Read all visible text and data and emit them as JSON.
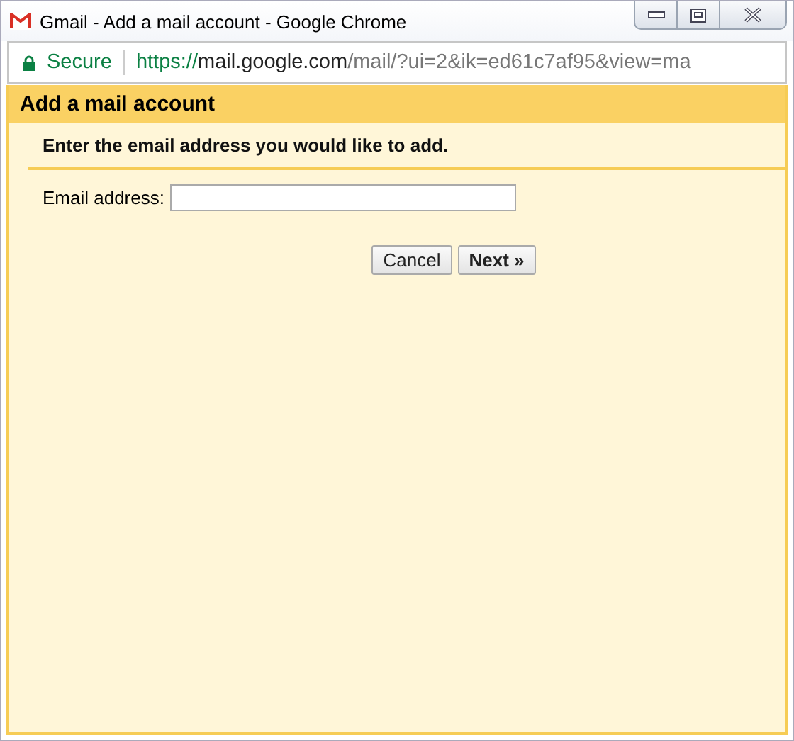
{
  "window": {
    "title": "Gmail - Add a mail account - Google Chrome"
  },
  "address_bar": {
    "security": "Secure",
    "url_scheme": "https://",
    "url_host": "mail.google.com",
    "url_path": "/mail/?ui=2&ik=ed61c7af95&view=ma"
  },
  "dialog": {
    "title": "Add a mail account",
    "instruction": "Enter the email address you would like to add.",
    "email_field": {
      "label": "Email address:"
    },
    "buttons": [
      {
        "label": "Cancel",
        "kind": "secondary"
      },
      {
        "label": "Next »",
        "kind": "primary"
      }
    ]
  }
}
